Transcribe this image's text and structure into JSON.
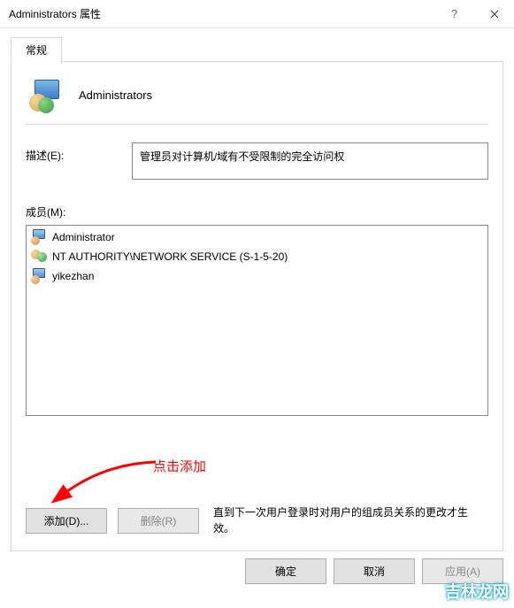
{
  "titlebar": {
    "title": "Administrators 属性"
  },
  "tabs": {
    "general": "常规"
  },
  "header": {
    "group_name": "Administrators"
  },
  "description": {
    "label": "描述(E):",
    "value": "管理员对计算机/域有不受限制的完全访问权"
  },
  "members": {
    "label": "成员(M):",
    "items": [
      {
        "icon": "single",
        "name": "Administrator"
      },
      {
        "icon": "multi",
        "name": "NT AUTHORITY\\NETWORK SERVICE (S-1-5-20)"
      },
      {
        "icon": "single",
        "name": "yikezhan"
      }
    ]
  },
  "annotation": {
    "text": "点击添加"
  },
  "buttons": {
    "add": "添加(D)...",
    "remove": "删除(R)",
    "note": "直到下一次用户登录时对用户的组成员关系的更改才生效。",
    "ok": "确定",
    "cancel": "取消",
    "apply": "应用(A)"
  },
  "watermark": "吉林龙网"
}
